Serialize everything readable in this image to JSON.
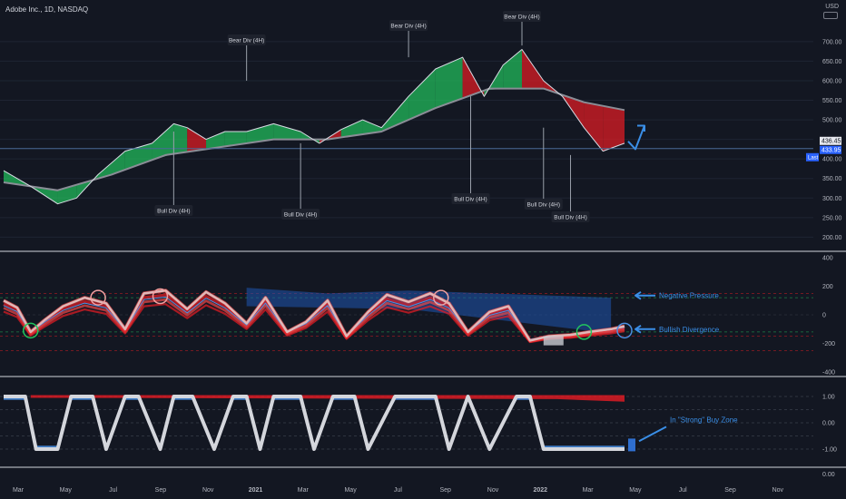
{
  "header": {
    "title": "Adobe Inc., 1D, NASDAQ",
    "currency": "USD"
  },
  "theme": {
    "background": "#131722",
    "grid": "#1e2433",
    "axis_text": "#b2b5be",
    "bull": "#22c55e",
    "bear": "#e81c24",
    "blue": "#2f6fd0",
    "ma_gray": "#8a8d96"
  },
  "chart_data": [
    {
      "type": "line",
      "panel": "price",
      "ylabel": "USD",
      "y_ticks": [
        200,
        250,
        300,
        350,
        400,
        450,
        500,
        550,
        600,
        650,
        700
      ],
      "ylim": [
        180,
        760
      ],
      "x_ticks": [
        "Mar",
        "May",
        "Jul",
        "Sep",
        "Nov",
        "2021",
        "Mar",
        "May",
        "Jul",
        "Sep",
        "Nov",
        "2022",
        "Mar",
        "May",
        "Jul",
        "Sep",
        "Nov"
      ],
      "series": [
        {
          "name": "Price",
          "x": [
            2020.0,
            2020.1,
            2020.2,
            2020.27,
            2020.35,
            2020.45,
            2020.55,
            2020.63,
            2020.68,
            2020.75,
            2020.82,
            2020.9,
            2021.0,
            2021.1,
            2021.17,
            2021.25,
            2021.33,
            2021.4,
            2021.5,
            2021.6,
            2021.7,
            2021.78,
            2021.85,
            2021.92,
            2022.0,
            2022.07,
            2022.15,
            2022.22,
            2022.3
          ],
          "y": [
            370,
            330,
            285,
            300,
            360,
            420,
            440,
            490,
            480,
            450,
            470,
            470,
            490,
            470,
            440,
            475,
            500,
            480,
            560,
            630,
            660,
            560,
            640,
            680,
            600,
            560,
            480,
            420,
            440
          ]
        },
        {
          "name": "MA",
          "x": [
            2020.0,
            2020.2,
            2020.4,
            2020.6,
            2020.8,
            2021.0,
            2021.2,
            2021.4,
            2021.6,
            2021.8,
            2022.0,
            2022.15,
            2022.3
          ],
          "y": [
            340,
            320,
            360,
            410,
            430,
            450,
            450,
            470,
            530,
            580,
            580,
            545,
            525
          ]
        }
      ],
      "reference_lines": [
        {
          "label": "Last",
          "value": 426.45
        }
      ],
      "price_labels": [
        "436.45",
        "433.95"
      ],
      "annotations": [
        "Bear Div (4H)",
        "Bear Div (4H)",
        "Bear Div (4H)",
        "Bull Div (4H)",
        "Bull Div (4H)",
        "Bull Div (4H)",
        "Bull Div (4H)",
        "Bull Div (4H)"
      ]
    },
    {
      "type": "line",
      "panel": "oscillator",
      "y_ticks": [
        400,
        200,
        0,
        -200,
        -400
      ],
      "ylim": [
        -400,
        400
      ],
      "series": [
        {
          "name": "Oscillator",
          "x": [
            2020.0,
            2020.05,
            2020.1,
            2020.15,
            2020.22,
            2020.3,
            2020.38,
            2020.45,
            2020.52,
            2020.6,
            2020.68,
            2020.75,
            2020.82,
            2020.9,
            2020.97,
            2021.05,
            2021.12,
            2021.2,
            2021.27,
            2021.35,
            2021.42,
            2021.5,
            2021.58,
            2021.65,
            2021.72,
            2021.8,
            2021.87,
            2021.95,
            2022.02,
            2022.1,
            2022.17,
            2022.25,
            2022.3
          ],
          "y": [
            100,
            50,
            -120,
            -40,
            60,
            120,
            80,
            -100,
            150,
            170,
            40,
            160,
            80,
            -60,
            120,
            -120,
            -50,
            100,
            -150,
            20,
            140,
            90,
            150,
            80,
            -120,
            20,
            60,
            -180,
            -150,
            -140,
            -120,
            -100,
            -80
          ]
        }
      ],
      "annotations": [
        "Negative Pressure",
        "Bullish Divergence"
      ]
    },
    {
      "type": "line",
      "panel": "zone",
      "y_ticks": [
        1.0,
        0.0,
        -1.0
      ],
      "ylim": [
        -1.3,
        1.3
      ],
      "series": [
        {
          "name": "Zone",
          "x": [
            2020.0,
            2020.08,
            2020.12,
            2020.2,
            2020.25,
            2020.33,
            2020.38,
            2020.45,
            2020.5,
            2020.58,
            2020.63,
            2020.7,
            2020.78,
            2020.85,
            2020.9,
            2020.95,
            2021.0,
            2021.1,
            2021.15,
            2021.22,
            2021.3,
            2021.35,
            2021.45,
            2021.52,
            2021.6,
            2021.65,
            2021.72,
            2021.8,
            2021.9,
            2021.95,
            2022.0,
            2022.1,
            2022.2,
            2022.3
          ],
          "y": [
            1.0,
            1.0,
            -1.0,
            -1.0,
            1.0,
            1.0,
            -1.0,
            1.0,
            1.0,
            -1.0,
            1.0,
            1.0,
            -1.0,
            1.0,
            1.0,
            -1.0,
            1.0,
            1.0,
            -1.0,
            1.0,
            1.0,
            -1.0,
            1.0,
            1.0,
            1.0,
            -1.0,
            1.0,
            -1.0,
            1.0,
            1.0,
            -1.0,
            -1.0,
            -1.0,
            -1.0
          ]
        }
      ],
      "annotations": [
        "In \"Strong\" Buy Zone"
      ]
    },
    {
      "type": "line",
      "panel": "bottom",
      "y_ticks": [
        0.0
      ]
    }
  ]
}
